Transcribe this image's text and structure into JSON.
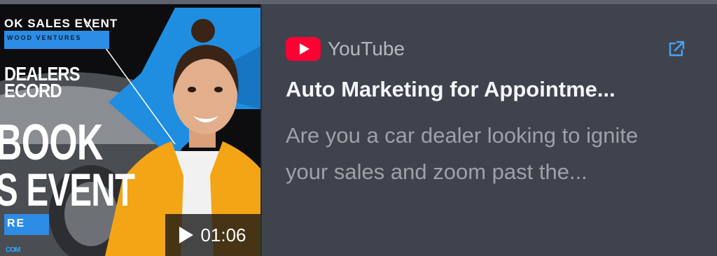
{
  "thumbnail": {
    "overlay": {
      "headline_top": "OK SALES EVENT",
      "subline": "WOOD VENTURES",
      "line_dealers": "DEALERS",
      "line_record": "ECORD",
      "line_book": "BOOK",
      "line_event": "S EVENT",
      "button_text": "RE",
      "url_fragment": "COM"
    },
    "duration": "01:06"
  },
  "source": {
    "name": "YouTube",
    "brand_color": "#ff0033"
  },
  "title": "Auto Marketing for Appointme...",
  "description": "Are you a car dealer looking to ignite your sales and zoom past the...",
  "icons": {
    "external_link": "external-link-icon",
    "play": "play-icon",
    "youtube": "youtube-logo-icon"
  },
  "colors": {
    "card_bg": "#3f434d",
    "accent_blue": "#2d8ce6",
    "title": "#f4f5f7",
    "desc": "#9da1aa"
  }
}
